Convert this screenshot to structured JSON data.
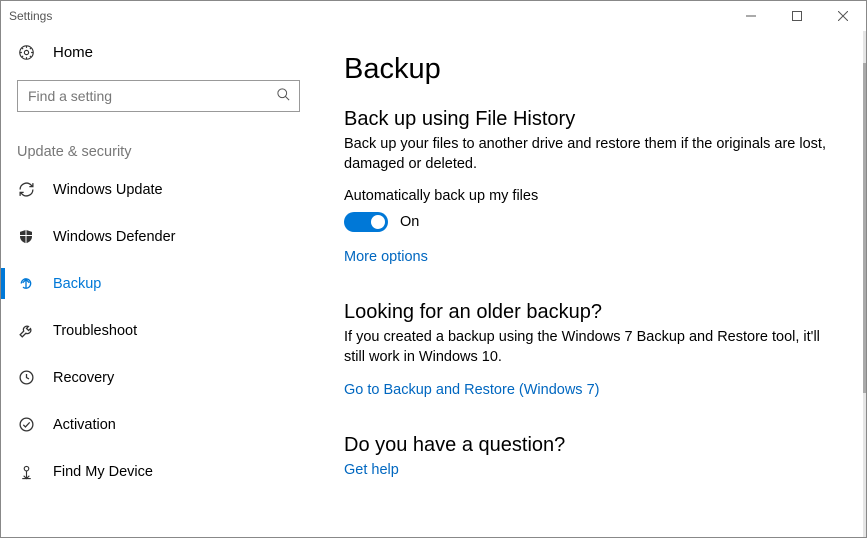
{
  "window": {
    "title": "Settings"
  },
  "sidebar": {
    "home": "Home",
    "search_placeholder": "Find a setting",
    "category": "Update & security",
    "items": [
      {
        "label": "Windows Update"
      },
      {
        "label": "Windows Defender"
      },
      {
        "label": "Backup"
      },
      {
        "label": "Troubleshoot"
      },
      {
        "label": "Recovery"
      },
      {
        "label": "Activation"
      },
      {
        "label": "Find My Device"
      }
    ]
  },
  "main": {
    "title": "Backup",
    "sec1": {
      "heading": "Back up using File History",
      "desc": "Back up your files to another drive and restore them if the originals are lost, damaged or deleted.",
      "toggle_label": "Automatically back up my files",
      "toggle_state": "On",
      "link": "More options"
    },
    "sec2": {
      "heading": "Looking for an older backup?",
      "desc": "If you created a backup using the Windows 7 Backup and Restore tool, it'll still work in Windows 10.",
      "link": "Go to Backup and Restore (Windows 7)"
    },
    "sec3": {
      "heading": "Do you have a question?",
      "link": "Get help"
    }
  }
}
